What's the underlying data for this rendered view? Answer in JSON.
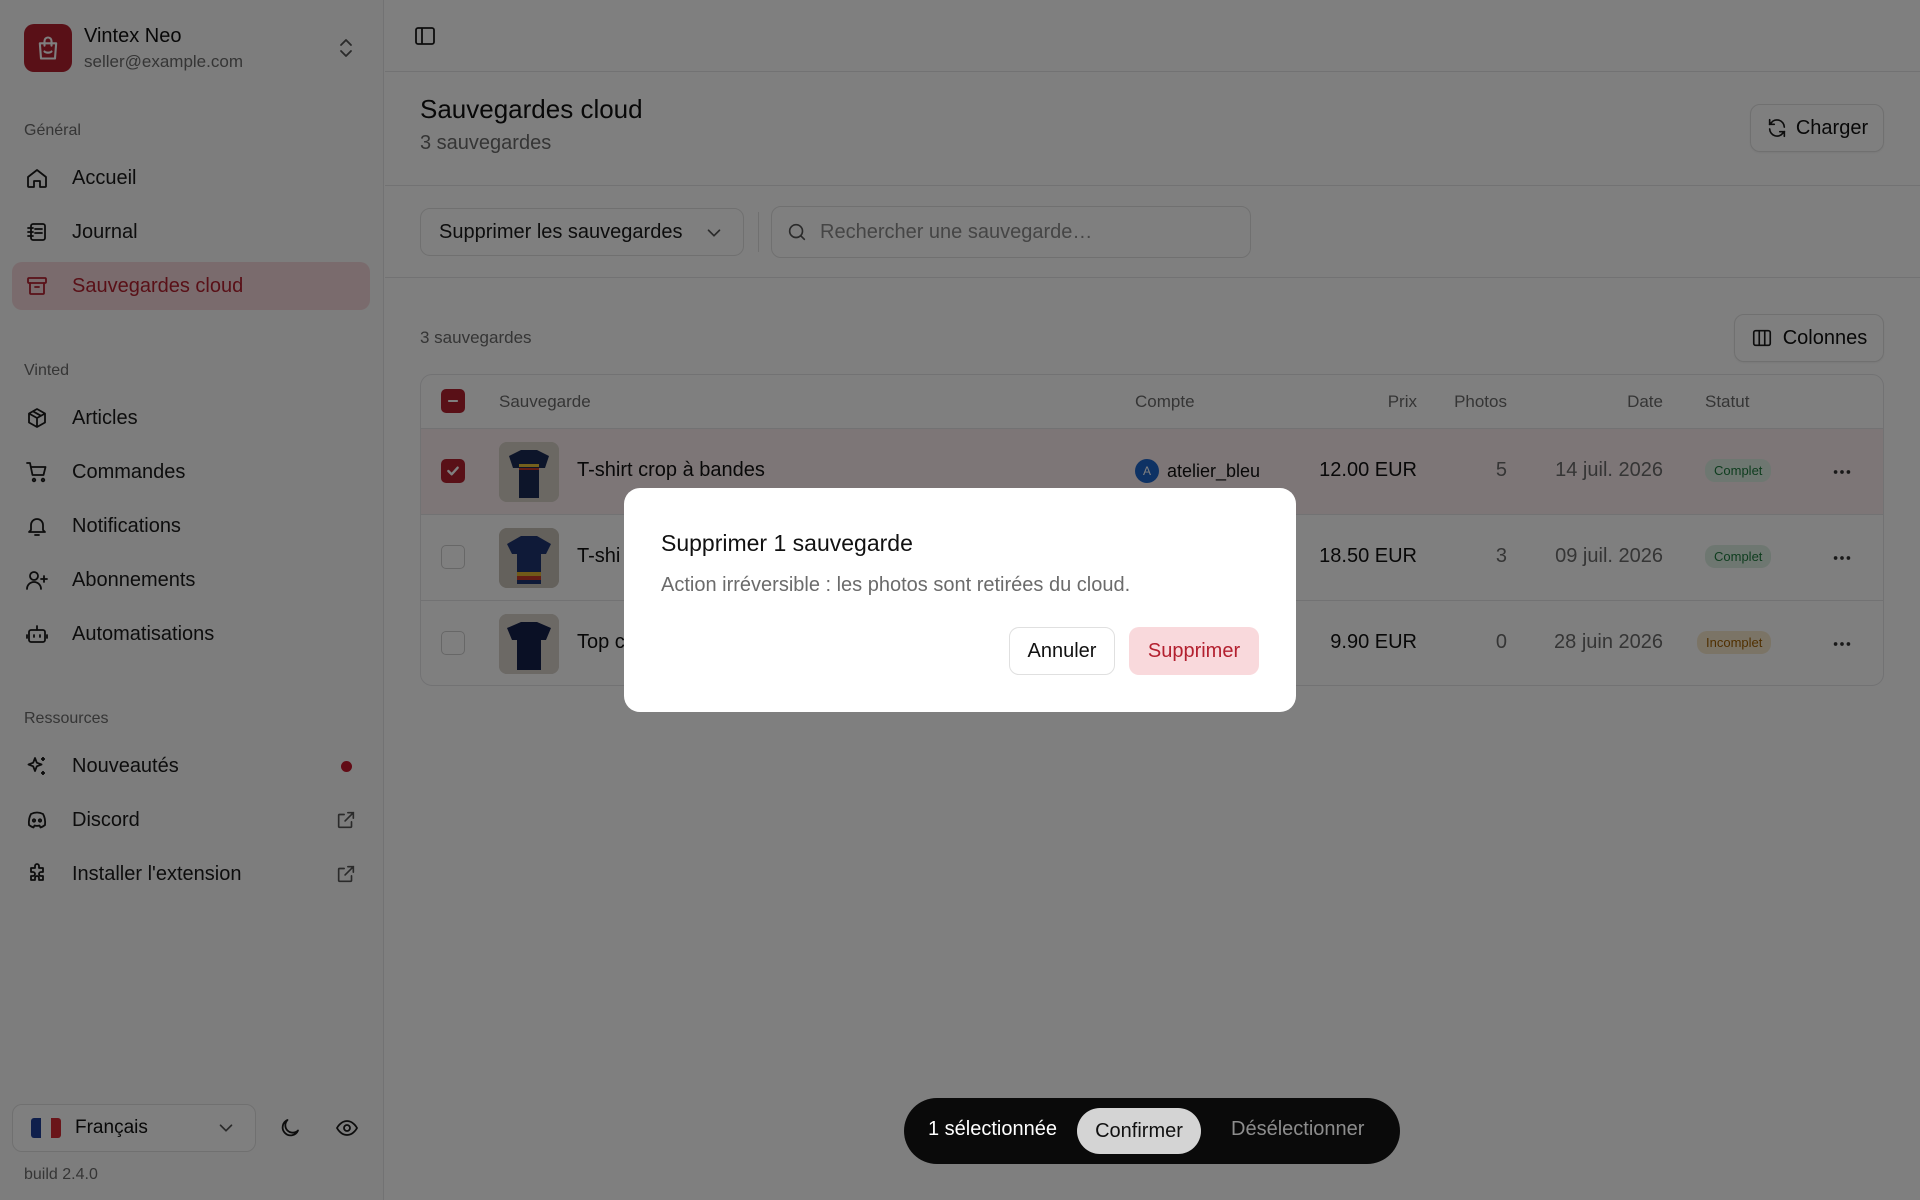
{
  "app": {
    "name": "Vintex Neo",
    "email": "seller@example.com",
    "build": "build 2.4.0"
  },
  "sidebar": {
    "sections": [
      "Général",
      "Vinted",
      "Ressources"
    ],
    "general": [
      {
        "label": "Accueil",
        "icon": "home-icon"
      },
      {
        "label": "Journal",
        "icon": "journal-icon"
      },
      {
        "label": "Sauvegardes cloud",
        "icon": "archive-icon",
        "active": true
      }
    ],
    "vinted": [
      {
        "label": "Articles",
        "icon": "package-icon"
      },
      {
        "label": "Commandes",
        "icon": "cart-icon"
      },
      {
        "label": "Notifications",
        "icon": "bell-icon"
      },
      {
        "label": "Abonnements",
        "icon": "user-plus-icon"
      },
      {
        "label": "Automatisations",
        "icon": "bot-icon"
      }
    ],
    "resources": [
      {
        "label": "Nouveautés",
        "icon": "sparkles-icon"
      },
      {
        "label": "Discord",
        "icon": "discord-icon"
      },
      {
        "label": "Installer l'extension",
        "icon": "puzzle-icon"
      }
    ],
    "language": "Français"
  },
  "page": {
    "title": "Sauvegardes cloud",
    "subtitle": "3 sauvegardes",
    "load_button": "Charger",
    "action_select": "Supprimer les sauvegardes",
    "search_placeholder": "Rechercher une sauvegarde…",
    "count_label": "3 sauvegardes",
    "columns_button": "Colonnes"
  },
  "table": {
    "headers": {
      "name": "Sauvegarde",
      "account": "Compte",
      "price": "Prix",
      "photos": "Photos",
      "date": "Date",
      "status": "Statut"
    },
    "rows": [
      {
        "title": "T-shirt crop à bandes",
        "account": "atelier_bleu",
        "account_initial": "A",
        "price": "12.00 EUR",
        "photos": "5",
        "date": "14 juil. 2026",
        "status": "Complet",
        "selected": true
      },
      {
        "title": "T-shi",
        "price": "18.50 EUR",
        "photos": "3",
        "date": "09 juil. 2026",
        "status": "Complet",
        "selected": false
      },
      {
        "title": "Top c",
        "price": "9.90 EUR",
        "photos": "0",
        "date": "28 juin 2026",
        "status": "Incomplet",
        "selected": false
      }
    ]
  },
  "dialog": {
    "title": "Supprimer 1 sauvegarde",
    "description": "Action irréversible : les photos sont retirées du cloud.",
    "cancel": "Annuler",
    "confirm": "Supprimer"
  },
  "bulk_bar": {
    "count": "1 sélectionnée",
    "confirm": "Confirmer",
    "deselect": "Désélectionner"
  },
  "colors": {
    "brand": "#b3202f",
    "active_bg": "#f5d7da",
    "ok": "#1f7a3f",
    "warn": "#a05f00"
  }
}
